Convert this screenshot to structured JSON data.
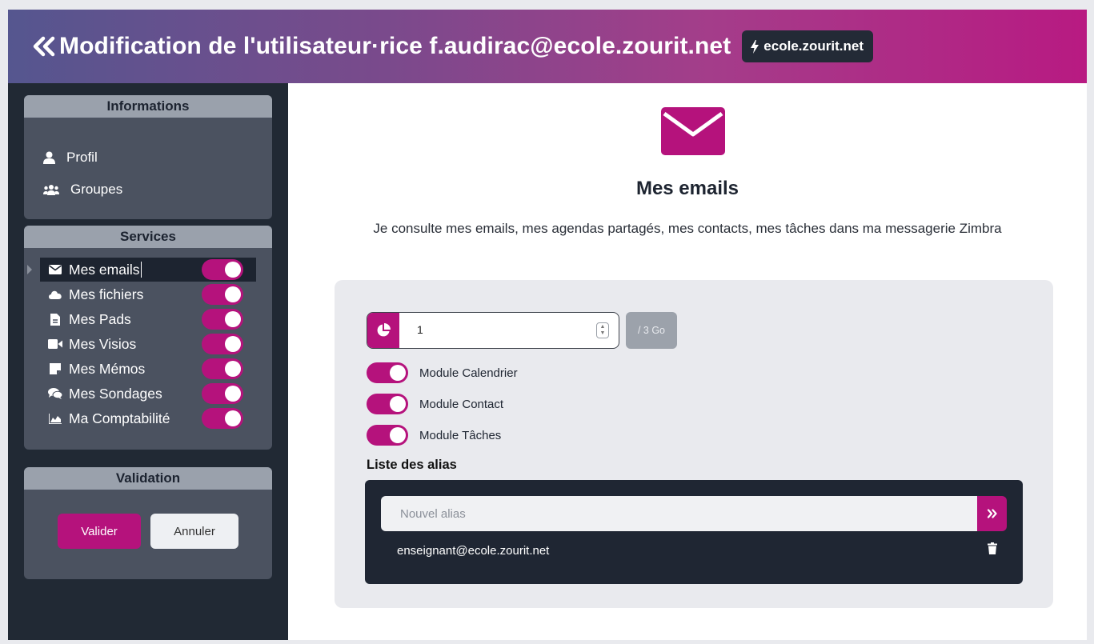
{
  "header": {
    "back_icon": "double-chevron-left-icon",
    "title": "Modification de l'utilisateur·rice f.audirac@ecole.zourit.net",
    "domain_icon": "bolt-icon",
    "domain": "ecole.zourit.net"
  },
  "sidebar": {
    "informations": {
      "title": "Informations",
      "items": [
        {
          "label": "Profil",
          "icon": "user-icon"
        },
        {
          "label": "Groupes",
          "icon": "users-icon"
        }
      ]
    },
    "services": {
      "title": "Services",
      "items": [
        {
          "label": "Mes emails",
          "icon": "envelope-icon",
          "enabled": true,
          "active": true
        },
        {
          "label": "Mes fichiers",
          "icon": "cloud-icon",
          "enabled": true
        },
        {
          "label": "Mes Pads",
          "icon": "file-text-icon",
          "enabled": true
        },
        {
          "label": "Mes Visios",
          "icon": "video-icon",
          "enabled": true
        },
        {
          "label": "Mes Mémos",
          "icon": "sticky-note-icon",
          "enabled": true
        },
        {
          "label": "Mes Sondages",
          "icon": "comments-icon",
          "enabled": true
        },
        {
          "label": "Ma Comptabilité",
          "icon": "chart-area-icon",
          "enabled": true
        }
      ]
    },
    "validation": {
      "title": "Validation",
      "valider": "Valider",
      "annuler": "Annuler"
    }
  },
  "main": {
    "icon": "envelope-icon",
    "title": "Mes emails",
    "description": "Je consulte mes emails, mes agendas partagés, mes contacts, mes tâches dans ma messagerie Zimbra",
    "quota": {
      "icon": "pie-chart-icon",
      "value": "1",
      "max": "/ 3 Go"
    },
    "modules": [
      {
        "label": "Module Calendrier",
        "enabled": true
      },
      {
        "label": "Module Contact",
        "enabled": true
      },
      {
        "label": "Module Tâches",
        "enabled": true
      }
    ],
    "alias": {
      "title": "Liste des alias",
      "placeholder": "Nouvel alias",
      "add_icon": "double-chevron-right-icon",
      "items": [
        "enseignant@ecole.zourit.net"
      ],
      "delete_icon": "trash-icon"
    }
  },
  "colors": {
    "accent": "#b5127c",
    "sidebar_bg": "#212934",
    "panel_bg": "#4b5260",
    "panel_head": "#9aa1ac"
  }
}
